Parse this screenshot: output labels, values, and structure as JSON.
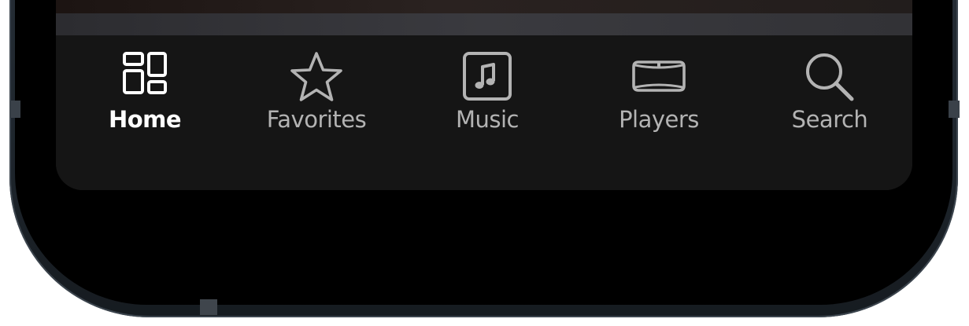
{
  "tabbar": {
    "items": [
      {
        "label": "Home",
        "icon": "home-grid-icon",
        "active": true
      },
      {
        "label": "Favorites",
        "icon": "star-icon",
        "active": false
      },
      {
        "label": "Music",
        "icon": "music-note-icon",
        "active": false
      },
      {
        "label": "Players",
        "icon": "speaker-icon",
        "active": false
      },
      {
        "label": "Search",
        "icon": "search-icon",
        "active": false
      }
    ]
  },
  "colors": {
    "active": "#ffffff",
    "inactive": "#b3b3b3",
    "tabbar_bg": "#151515"
  }
}
